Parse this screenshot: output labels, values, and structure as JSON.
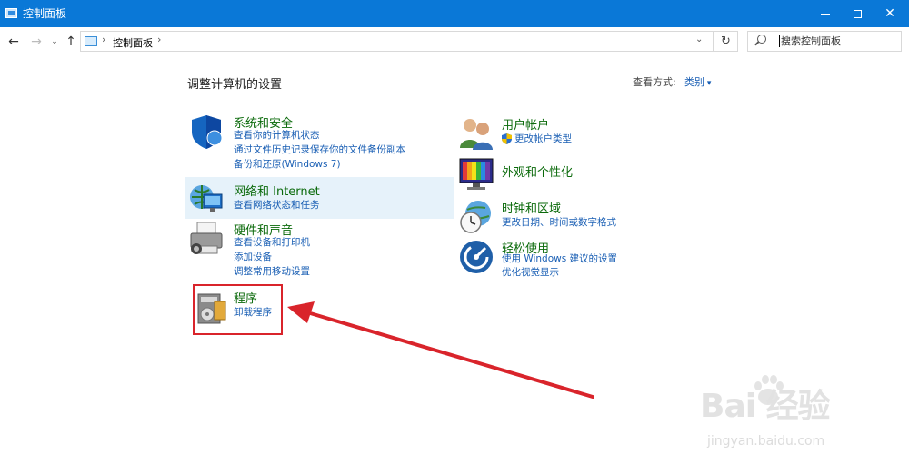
{
  "window": {
    "title": "控制面板"
  },
  "nav": {
    "back": "←",
    "forward": "→",
    "recent": "⌄",
    "up": "↑",
    "breadcrumb": "控制面板",
    "refresh": "↻",
    "search_placeholder": "搜索控制面板"
  },
  "content": {
    "heading": "调整计算机的设置",
    "view_by_label": "查看方式:",
    "view_by_value": "类别",
    "left_categories": [
      {
        "title": "系统和安全",
        "links": [
          "查看你的计算机状态",
          "通过文件历史记录保存你的文件备份副本",
          "备份和还原(Windows 7)"
        ]
      },
      {
        "title": "网络和 Internet",
        "links": [
          "查看网络状态和任务"
        ]
      },
      {
        "title": "硬件和声音",
        "links": [
          "查看设备和打印机",
          "添加设备",
          "调整常用移动设置"
        ]
      },
      {
        "title": "程序",
        "links": [
          "卸载程序"
        ]
      }
    ],
    "right_categories": [
      {
        "title": "用户帐户",
        "links": [
          "更改帐户类型"
        ]
      },
      {
        "title": "外观和个性化",
        "links": []
      },
      {
        "title": "时钟和区域",
        "links": [
          "更改日期、时间或数字格式"
        ]
      },
      {
        "title": "轻松使用",
        "links": [
          "使用 Windows 建议的设置",
          "优化视觉显示"
        ]
      }
    ]
  },
  "watermark": {
    "brand": "Bai 经验",
    "url": "jingyan.baidu.com"
  },
  "colors": {
    "titlebar": "#0a78d7",
    "category_title": "#0b6a0b",
    "link": "#1a5fb4",
    "annotation_red": "#d9242b"
  }
}
